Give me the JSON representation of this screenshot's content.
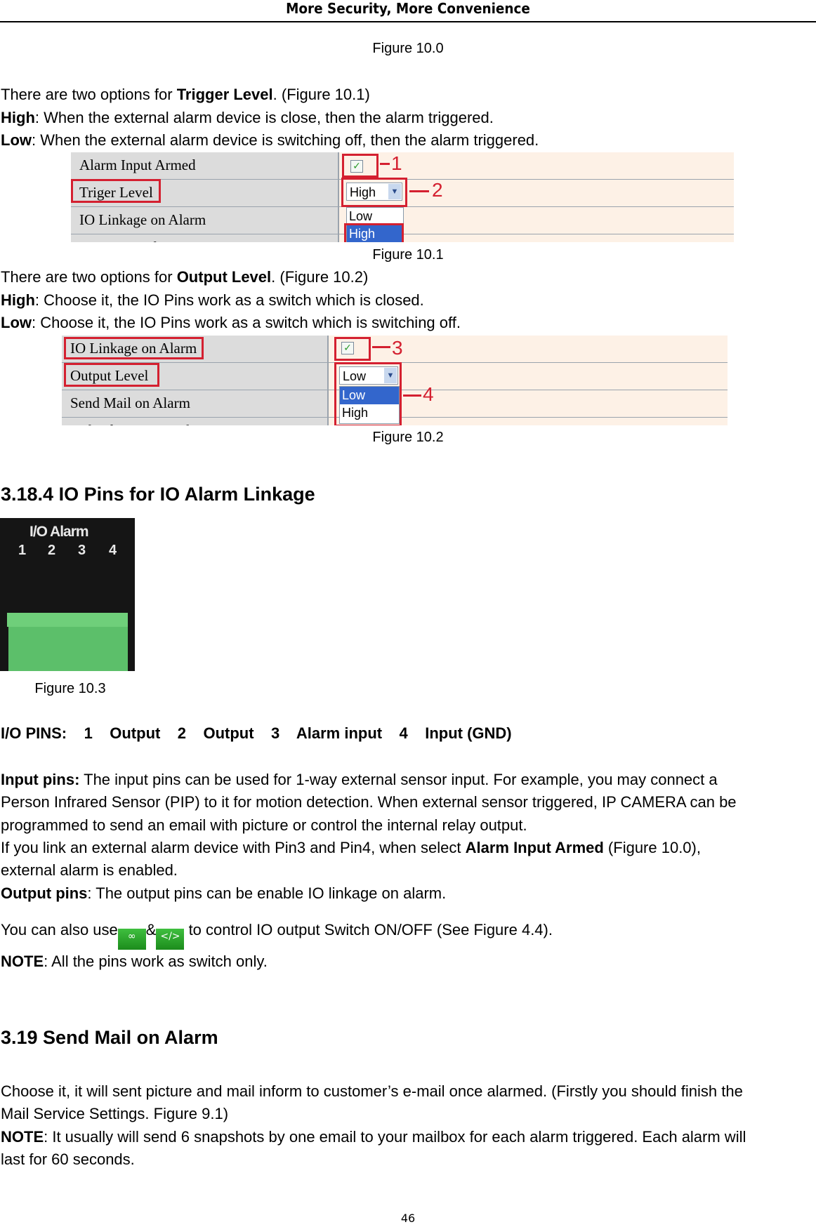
{
  "header": {
    "title": "More Security, More Convenience"
  },
  "captions": {
    "fig10_0": "Figure 10.0",
    "fig10_1": "Figure 10.1",
    "fig10_2": "Figure 10.2",
    "fig10_3": "Figure 10.3"
  },
  "trigger": {
    "intro_pre": "There are two options for ",
    "intro_bold": "Trigger Level",
    "intro_post": ". (Figure 10.1)",
    "high_label": "High",
    "high_text": ": When the external alarm device is close, then the alarm triggered.",
    "low_label": "Low",
    "low_text": ": When the external alarm device is switching off, then the alarm triggered."
  },
  "fig10_1": {
    "rows": [
      "Alarm Input Armed",
      "Triger Level",
      "IO Linkage on Alarm",
      "Output Level"
    ],
    "checkbox_checked": true,
    "select_value": "High",
    "options": [
      "Low",
      "High"
    ],
    "selected_option": "High",
    "markers": [
      "1",
      "2"
    ]
  },
  "output": {
    "intro_pre": "There are two options for ",
    "intro_bold": "Output Level",
    "intro_post": ". (Figure 10.2)",
    "high_label": "High",
    "high_text": ": Choose it, the IO Pins work as a switch which is closed.",
    "low_label": "Low",
    "low_text": ": Choose it, the IO Pins work as a switch which is switching off."
  },
  "fig10_2": {
    "rows": [
      "IO Linkage on Alarm",
      "Output Level",
      "Send Mail on Alarm",
      "Upload Image on Alarm"
    ],
    "checkbox_checked": true,
    "select_value": "Low",
    "options": [
      "Low",
      "High"
    ],
    "selected_option": "Low",
    "markers": [
      "3",
      "4"
    ]
  },
  "section_io": {
    "heading": "3.18.4 IO Pins for IO Alarm Linkage",
    "image": {
      "title": "I/O Alarm",
      "pins": [
        "1",
        "2",
        "3",
        "4"
      ]
    },
    "pins_line": "I/O PINS:    1    Output    2    Output    3    Alarm input    4    Input (GND)",
    "input_bold": "Input pins:",
    "input_l1": " The input pins can be used for 1-way external sensor input. For example, you may connect a",
    "input_l2": "Person Infrared Sensor (PIP) to it for motion detection. When external sensor triggered, IP CAMERA can be",
    "input_l3": "programmed to send an email with picture or control the internal relay output.",
    "link_pre": "If you link an external alarm device with Pin3 and Pin4, when select ",
    "link_bold": "Alarm Input Armed",
    "link_post": " (Figure 10.0),",
    "link_l2": "external alarm is enabled.",
    "output_bold": "Output pins",
    "output_text": ": The output pins can be enable IO linkage on alarm.",
    "also_pre": "You can also use",
    "also_amp": "&",
    "also_post": "  to control IO output Switch ON/OFF (See Figure 4.4).",
    "icons": [
      "io-on-icon",
      "io-off-icon"
    ],
    "note_bold": "NOTE",
    "note_text": ": All the pins work as switch only."
  },
  "section_mail": {
    "heading": "3.19 Send Mail on Alarm",
    "l1": "Choose it, it will sent picture and mail inform to customer’s e-mail once alarmed. (Firstly you should finish the",
    "l2": "Mail Service Settings. Figure 9.1)",
    "note_bold": "NOTE",
    "note_l1": ": It usually will send 6 snapshots by one email to your mailbox for each alarm triggered. Each alarm will",
    "note_l2": "last for 60 seconds."
  },
  "page_number": "46"
}
